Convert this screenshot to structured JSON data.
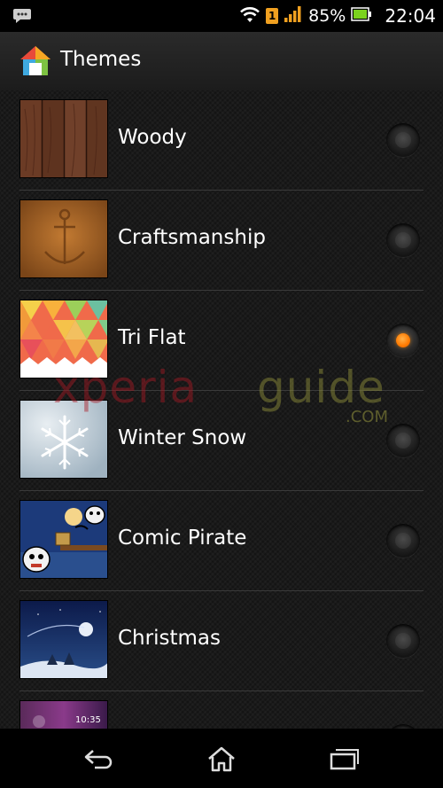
{
  "status_bar": {
    "battery_percent": "85%",
    "time": "22:04",
    "notification_badge": "1",
    "icons": [
      "messenger-icon",
      "wifi-icon",
      "sim-notification-icon",
      "signal-icon",
      "battery-icon"
    ]
  },
  "action_bar": {
    "title": "Themes",
    "icon": "themes-app-icon"
  },
  "themes": [
    {
      "name": "Woody",
      "selected": false
    },
    {
      "name": "Craftsmanship",
      "selected": false
    },
    {
      "name": "Tri Flat",
      "selected": true
    },
    {
      "name": "Winter Snow",
      "selected": false
    },
    {
      "name": "Comic Pirate",
      "selected": false
    },
    {
      "name": "Christmas",
      "selected": false
    },
    {
      "name": "",
      "selected": false,
      "thumb_time": "10:35"
    }
  ],
  "watermark": {
    "part1": "xperia",
    "part2": "guide",
    "part3": ".COM"
  },
  "nav_bar": {
    "icons": [
      "back-icon",
      "home-icon",
      "recent-apps-icon"
    ]
  },
  "colors": {
    "accent": "#ff8a00",
    "background": "#1a1a1a"
  }
}
